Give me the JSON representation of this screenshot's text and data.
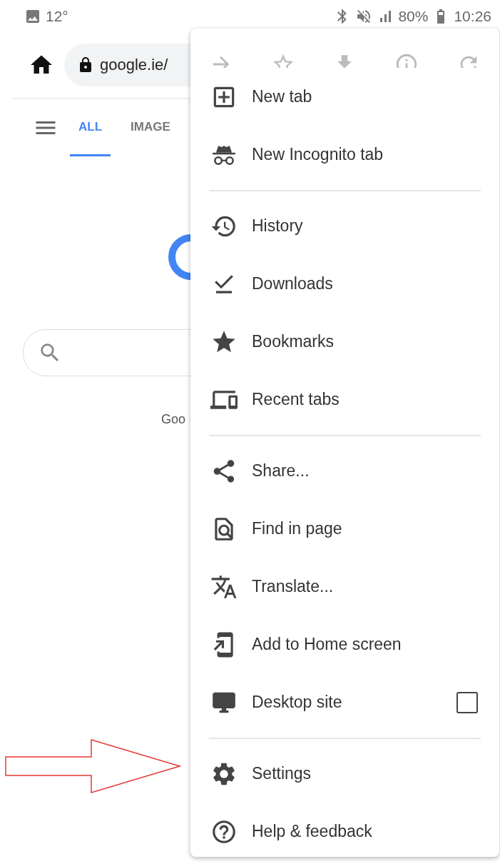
{
  "status_bar": {
    "temperature": "12°",
    "battery": "80%",
    "time": "10:26"
  },
  "toolbar": {
    "url": "google.ie/"
  },
  "search_tabs": [
    {
      "label": "ALL",
      "selected": true
    },
    {
      "label": "IMAGE",
      "selected": false
    }
  ],
  "footer_text": "Goo",
  "menu": {
    "items": [
      {
        "kind": "item",
        "label": "New tab"
      },
      {
        "kind": "item",
        "label": "New Incognito tab"
      },
      {
        "kind": "divider"
      },
      {
        "kind": "item",
        "label": "History"
      },
      {
        "kind": "item",
        "label": "Downloads"
      },
      {
        "kind": "item",
        "label": "Bookmarks"
      },
      {
        "kind": "item",
        "label": "Recent tabs"
      },
      {
        "kind": "divider"
      },
      {
        "kind": "item",
        "label": "Share..."
      },
      {
        "kind": "item",
        "label": "Find in page"
      },
      {
        "kind": "item",
        "label": "Translate..."
      },
      {
        "kind": "item",
        "label": "Add to Home screen"
      },
      {
        "kind": "checkbox",
        "label": "Desktop site",
        "checked": false
      },
      {
        "kind": "divider"
      },
      {
        "kind": "item",
        "label": "Settings"
      },
      {
        "kind": "item",
        "label": "Help & feedback"
      }
    ]
  }
}
